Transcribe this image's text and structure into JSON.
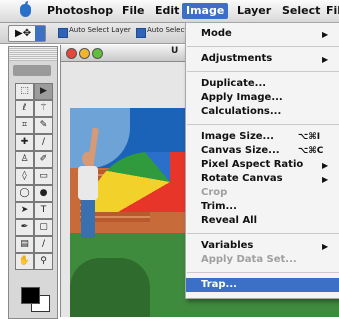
{
  "menubar": {
    "items": [
      "Photoshop",
      "File",
      "Edit",
      "Image",
      "Layer",
      "Select",
      "Fil"
    ],
    "active_index": 3
  },
  "options_bar": {
    "checkbox1_label": "Auto Select Layer",
    "checkbox2_label": "Auto Select"
  },
  "document": {
    "title_fragment": "U"
  },
  "image_menu": {
    "items": [
      {
        "label": "Mode",
        "shortcut": "",
        "submenu": true,
        "disabled": false
      },
      {
        "label": "Adjustments",
        "shortcut": "",
        "submenu": true,
        "disabled": false
      },
      {
        "label": "Duplicate...",
        "shortcut": "",
        "submenu": false,
        "disabled": false
      },
      {
        "label": "Apply Image...",
        "shortcut": "",
        "submenu": false,
        "disabled": false
      },
      {
        "label": "Calculations...",
        "shortcut": "",
        "submenu": false,
        "disabled": false
      },
      {
        "label": "Image Size...",
        "shortcut": "⌥⌘I",
        "submenu": false,
        "disabled": false
      },
      {
        "label": "Canvas Size...",
        "shortcut": "⌥⌘C",
        "submenu": false,
        "disabled": false
      },
      {
        "label": "Pixel Aspect Ratio",
        "shortcut": "",
        "submenu": true,
        "disabled": false
      },
      {
        "label": "Rotate Canvas",
        "shortcut": "",
        "submenu": true,
        "disabled": false
      },
      {
        "label": "Crop",
        "shortcut": "",
        "submenu": false,
        "disabled": true
      },
      {
        "label": "Trim...",
        "shortcut": "",
        "submenu": false,
        "disabled": false
      },
      {
        "label": "Reveal All",
        "shortcut": "",
        "submenu": false,
        "disabled": false
      },
      {
        "label": "Variables",
        "shortcut": "",
        "submenu": true,
        "disabled": false
      },
      {
        "label": "Apply Data Set...",
        "shortcut": "",
        "submenu": false,
        "disabled": true
      },
      {
        "label": "Trap...",
        "shortcut": "",
        "submenu": false,
        "disabled": false,
        "highlighted": true
      }
    ]
  },
  "colors": {
    "highlight": "#3c6fc6",
    "disabled_text": "#a0a0a0"
  }
}
